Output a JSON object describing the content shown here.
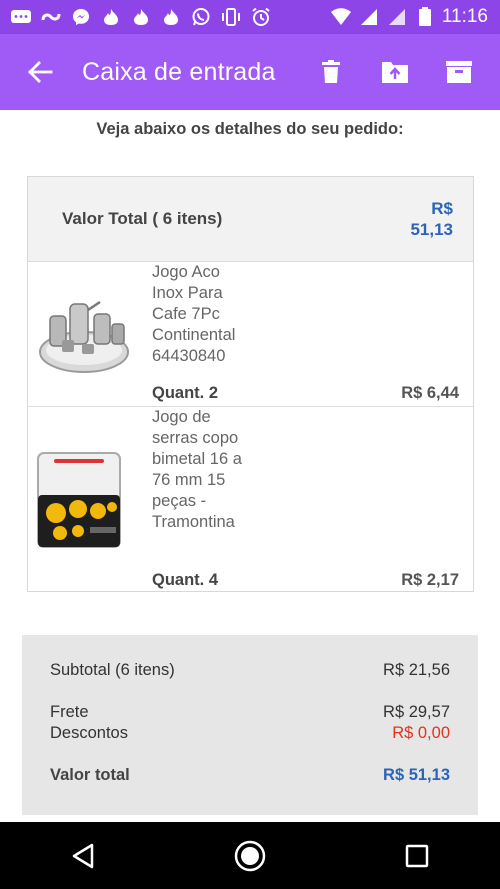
{
  "status_bar": {
    "time": "11:16",
    "left_icons": [
      "chat-icon",
      "infinity-icon",
      "messenger-icon",
      "fire-icon",
      "fire-icon",
      "fire-icon",
      "whatsapp-icon",
      "vibrate-icon",
      "alarm-icon",
      "wifi-icon",
      "signal-icon",
      "signal-icon",
      "battery-icon"
    ]
  },
  "app_bar": {
    "title": "Caixa de entrada",
    "back_icon": "back-arrow-icon",
    "actions": [
      "trash-icon",
      "move-icon",
      "archive-icon"
    ]
  },
  "intro_text": "Veja abaixo os detalhes do seu pedido:",
  "order": {
    "header_label": "Valor Total ( 6 itens)",
    "header_total_line1": "R$",
    "header_total_line2": "51,13",
    "items": [
      {
        "name": "Jogo Aco Inox Para Cafe 7Pc Continental 64430840",
        "quantity": "Quant. 2",
        "price": "R$ 6,44"
      },
      {
        "name": "Jogo de serras copo bimetal 16 a 76 mm 15 peças - Tramontina",
        "quantity": "Quant. 4",
        "price": "R$ 2,17"
      }
    ]
  },
  "summary": {
    "subtotal_label": "Subtotal (6 itens)",
    "subtotal_value": "R$ 21,56",
    "frete_label": "Frete",
    "frete_value": "R$ 29,57",
    "descontos_label": "Descontos",
    "descontos_value": "R$ 0,00",
    "total_label": "Valor total",
    "total_value": "R$ 51,13"
  },
  "colors": {
    "status_bar": "#8e45e8",
    "app_bar": "#a05af5",
    "price_blue": "#2c64b8",
    "discount_red": "#e0341e"
  },
  "nav_bar": [
    "back-triangle-icon",
    "home-circle-icon",
    "recents-square-icon"
  ]
}
